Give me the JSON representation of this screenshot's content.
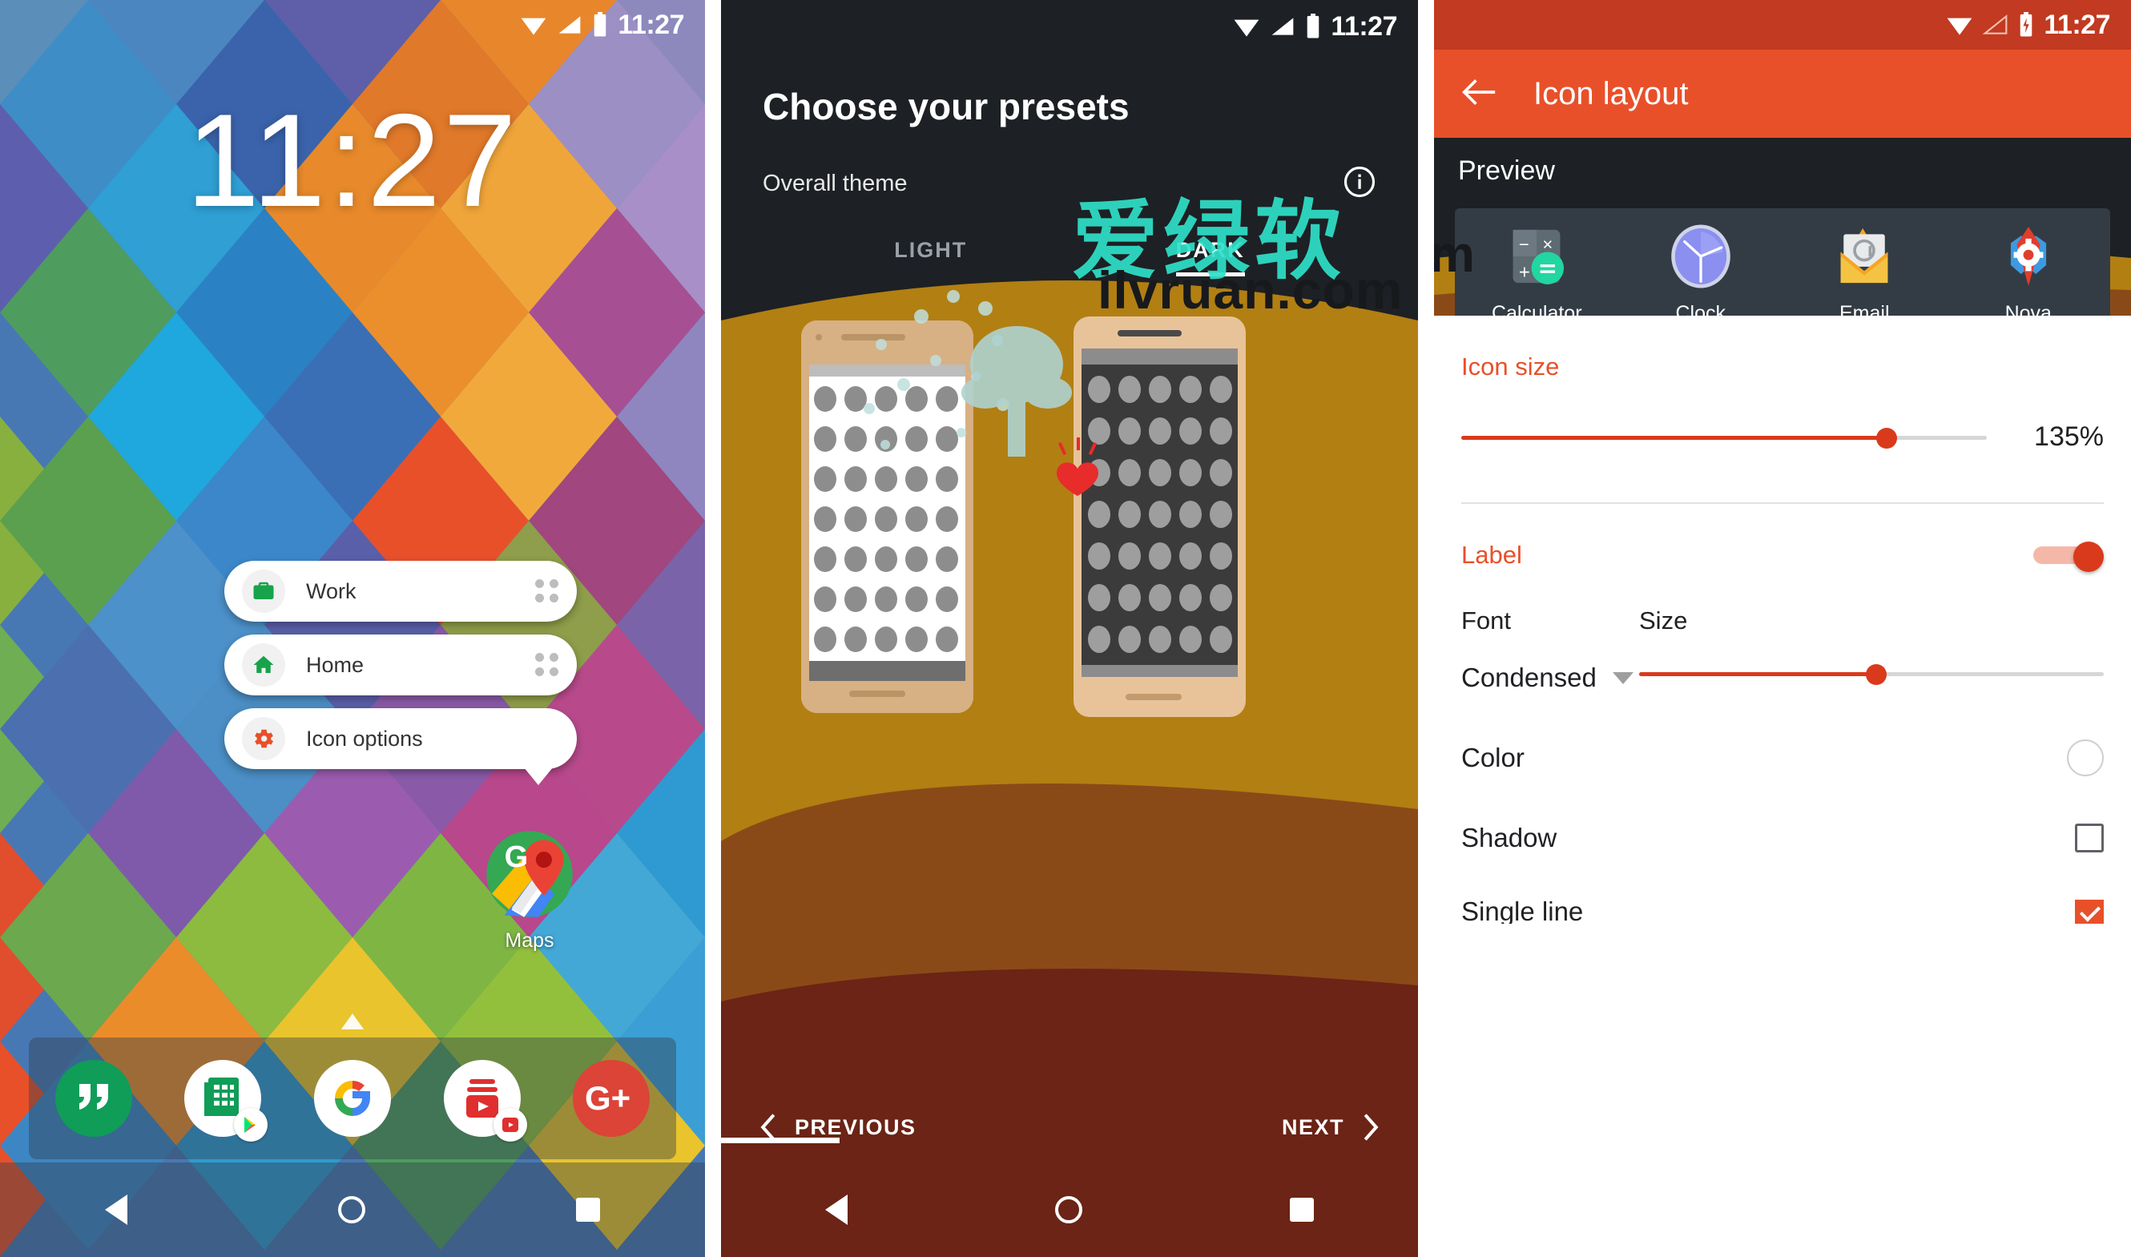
{
  "home_screen": {
    "status_bar": {
      "time": "11:27",
      "icons": [
        "wifi-icon",
        "signal-icon",
        "battery-icon"
      ]
    },
    "clock_widget": "11:27",
    "shortcut_popup": {
      "items": [
        {
          "label": "Work",
          "icon": "briefcase-icon",
          "icon_color": "#17a34a",
          "drag_handle": "grid-dots-icon"
        },
        {
          "label": "Home",
          "icon": "house-icon",
          "icon_color": "#17a34a",
          "drag_handle": "grid-dots-icon"
        },
        {
          "label": "Icon options",
          "icon": "gear-icon",
          "icon_color": "#e8502a",
          "drag_handle": ""
        }
      ]
    },
    "app_icon": {
      "label": "Maps",
      "icon": "google-maps-icon"
    },
    "dock": {
      "items": [
        {
          "name": "hangouts-icon",
          "label": "Hangouts",
          "badge": ""
        },
        {
          "name": "sheets-icon",
          "label": "Sheets",
          "badge": "play-store-badge"
        },
        {
          "name": "google-icon",
          "label": "Google",
          "badge": ""
        },
        {
          "name": "youtube-music-icon",
          "label": "YouTube Music",
          "badge": "play-store-badge"
        },
        {
          "name": "google-plus-icon",
          "label": "Google+",
          "badge": ""
        }
      ]
    },
    "nav_bar": {
      "back": "back-triangle-icon",
      "home": "home-circle-icon",
      "recents": "recents-square-icon"
    }
  },
  "presets_screen": {
    "status_bar": {
      "time": "11:27"
    },
    "title": "Choose your presets",
    "subtitle": "Overall theme",
    "info_icon": "info-icon",
    "tabs": [
      {
        "label": "LIGHT",
        "selected": false
      },
      {
        "label": "DARK",
        "selected": true
      }
    ],
    "previews": [
      {
        "theme": "light",
        "screen_color": "#ffffff"
      },
      {
        "theme": "dark",
        "screen_color": "#3b3b3b"
      }
    ],
    "footer": {
      "previous": "PREVIOUS",
      "next": "NEXT",
      "prev_icon": "chevron-left-icon",
      "next_icon": "chevron-right-icon"
    },
    "watermark": {
      "cn": "爱绿软",
      "url": "ilvruan.com",
      "tree": "tree-icon",
      "heart": "heart-icon"
    }
  },
  "icon_layout_screen": {
    "status_bar": {
      "time": "11:27",
      "icons": [
        "wifi-icon",
        "signal-icon",
        "battery-charging-icon"
      ]
    },
    "toolbar": {
      "back_icon": "arrow-back-icon",
      "title": "Icon layout"
    },
    "preview": {
      "heading": "Preview",
      "apps": [
        {
          "label": "Calculator",
          "icon": "calculator-icon"
        },
        {
          "label": "Clock",
          "icon": "clock-icon"
        },
        {
          "label": "Email",
          "icon": "email-icon"
        },
        {
          "label": "Nova Settings",
          "icon": "nova-settings-icon"
        }
      ]
    },
    "icon_size": {
      "title": "Icon size",
      "value": "135%",
      "percent": 81
    },
    "label": {
      "title": "Label",
      "toggle_on": true,
      "font_caption": "Font",
      "font_value": "Condensed",
      "size_caption": "Size",
      "size_percent": 51
    },
    "options": [
      {
        "label": "Color",
        "control": "color-swatch",
        "value": "#ffffff"
      },
      {
        "label": "Shadow",
        "control": "checkbox",
        "checked": false
      },
      {
        "label": "Single line",
        "control": "checkbox",
        "checked": true
      }
    ],
    "accent_color": "#e8502a"
  }
}
